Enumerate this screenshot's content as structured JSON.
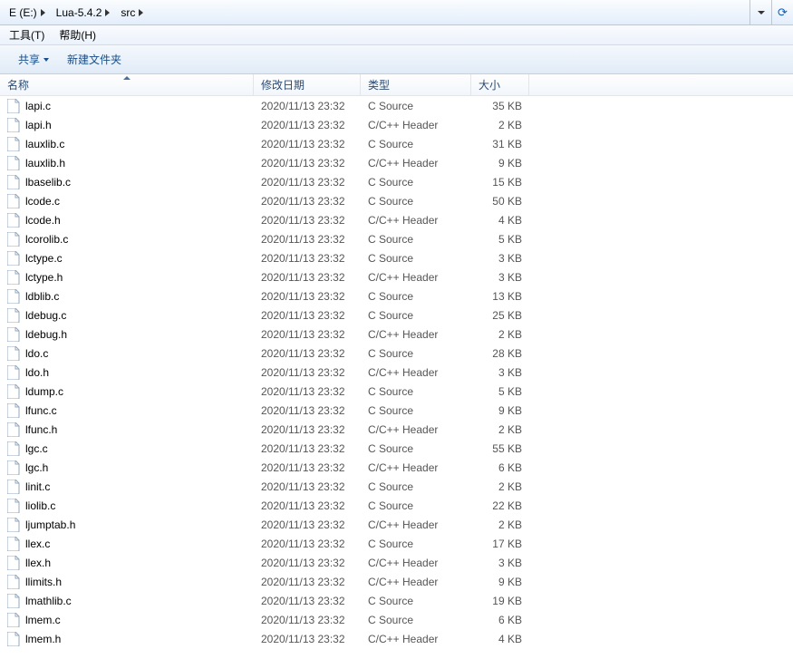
{
  "breadcrumbs": [
    "E (E:)",
    "Lua-5.4.2",
    "src"
  ],
  "menu": {
    "tools": "工具(T)",
    "help": "帮助(H)"
  },
  "toolbar": {
    "share": "共享",
    "new_folder": "新建文件夹"
  },
  "columns": {
    "name": "名称",
    "date": "修改日期",
    "type": "类型",
    "size": "大小"
  },
  "files": [
    {
      "name": "lapi.c",
      "date": "2020/11/13 23:32",
      "type": "C Source",
      "size": "35 KB"
    },
    {
      "name": "lapi.h",
      "date": "2020/11/13 23:32",
      "type": "C/C++ Header",
      "size": "2 KB"
    },
    {
      "name": "lauxlib.c",
      "date": "2020/11/13 23:32",
      "type": "C Source",
      "size": "31 KB"
    },
    {
      "name": "lauxlib.h",
      "date": "2020/11/13 23:32",
      "type": "C/C++ Header",
      "size": "9 KB"
    },
    {
      "name": "lbaselib.c",
      "date": "2020/11/13 23:32",
      "type": "C Source",
      "size": "15 KB"
    },
    {
      "name": "lcode.c",
      "date": "2020/11/13 23:32",
      "type": "C Source",
      "size": "50 KB"
    },
    {
      "name": "lcode.h",
      "date": "2020/11/13 23:32",
      "type": "C/C++ Header",
      "size": "4 KB"
    },
    {
      "name": "lcorolib.c",
      "date": "2020/11/13 23:32",
      "type": "C Source",
      "size": "5 KB"
    },
    {
      "name": "lctype.c",
      "date": "2020/11/13 23:32",
      "type": "C Source",
      "size": "3 KB"
    },
    {
      "name": "lctype.h",
      "date": "2020/11/13 23:32",
      "type": "C/C++ Header",
      "size": "3 KB"
    },
    {
      "name": "ldblib.c",
      "date": "2020/11/13 23:32",
      "type": "C Source",
      "size": "13 KB"
    },
    {
      "name": "ldebug.c",
      "date": "2020/11/13 23:32",
      "type": "C Source",
      "size": "25 KB"
    },
    {
      "name": "ldebug.h",
      "date": "2020/11/13 23:32",
      "type": "C/C++ Header",
      "size": "2 KB"
    },
    {
      "name": "ldo.c",
      "date": "2020/11/13 23:32",
      "type": "C Source",
      "size": "28 KB"
    },
    {
      "name": "ldo.h",
      "date": "2020/11/13 23:32",
      "type": "C/C++ Header",
      "size": "3 KB"
    },
    {
      "name": "ldump.c",
      "date": "2020/11/13 23:32",
      "type": "C Source",
      "size": "5 KB"
    },
    {
      "name": "lfunc.c",
      "date": "2020/11/13 23:32",
      "type": "C Source",
      "size": "9 KB"
    },
    {
      "name": "lfunc.h",
      "date": "2020/11/13 23:32",
      "type": "C/C++ Header",
      "size": "2 KB"
    },
    {
      "name": "lgc.c",
      "date": "2020/11/13 23:32",
      "type": "C Source",
      "size": "55 KB"
    },
    {
      "name": "lgc.h",
      "date": "2020/11/13 23:32",
      "type": "C/C++ Header",
      "size": "6 KB"
    },
    {
      "name": "linit.c",
      "date": "2020/11/13 23:32",
      "type": "C Source",
      "size": "2 KB"
    },
    {
      "name": "liolib.c",
      "date": "2020/11/13 23:32",
      "type": "C Source",
      "size": "22 KB"
    },
    {
      "name": "ljumptab.h",
      "date": "2020/11/13 23:32",
      "type": "C/C++ Header",
      "size": "2 KB"
    },
    {
      "name": "llex.c",
      "date": "2020/11/13 23:32",
      "type": "C Source",
      "size": "17 KB"
    },
    {
      "name": "llex.h",
      "date": "2020/11/13 23:32",
      "type": "C/C++ Header",
      "size": "3 KB"
    },
    {
      "name": "llimits.h",
      "date": "2020/11/13 23:32",
      "type": "C/C++ Header",
      "size": "9 KB"
    },
    {
      "name": "lmathlib.c",
      "date": "2020/11/13 23:32",
      "type": "C Source",
      "size": "19 KB"
    },
    {
      "name": "lmem.c",
      "date": "2020/11/13 23:32",
      "type": "C Source",
      "size": "6 KB"
    },
    {
      "name": "lmem.h",
      "date": "2020/11/13 23:32",
      "type": "C/C++ Header",
      "size": "4 KB"
    }
  ]
}
